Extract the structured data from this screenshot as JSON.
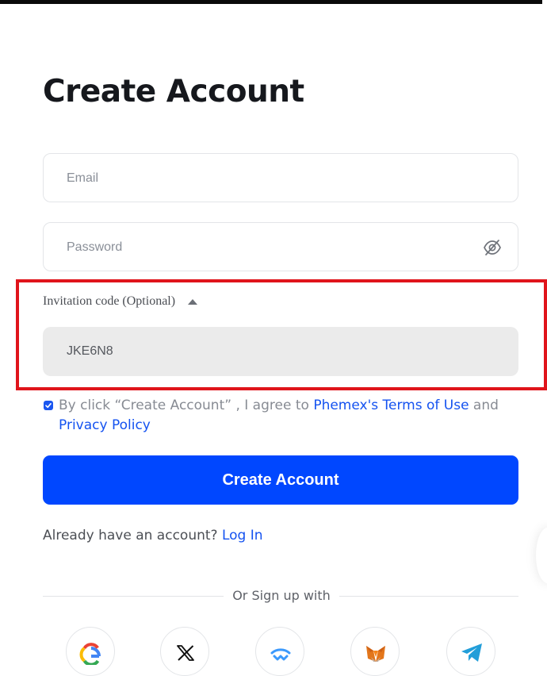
{
  "page": {
    "title": "Create Account"
  },
  "form": {
    "email_placeholder": "Email",
    "email_value": "",
    "password_placeholder": "Password",
    "password_value": "",
    "password_toggle_icon": "eye-slash-icon",
    "invitation_label": "Invitation code (Optional)",
    "invitation_toggle_icon": "caret-up-icon",
    "invitation_value": "JKE6N8"
  },
  "agreement": {
    "checked": true,
    "prefix": "By click “Create Account” , I agree to ",
    "terms_link": "Phemex's Terms of Use",
    "conjunction": " and ",
    "privacy_link": "Privacy Policy"
  },
  "submit": {
    "label": "Create Account"
  },
  "login": {
    "prompt": "Already have an account? ",
    "link": "Log In"
  },
  "social": {
    "divider_text": "Or Sign up with",
    "providers": [
      {
        "icon": "google-icon"
      },
      {
        "icon": "x-icon"
      },
      {
        "icon": "walletconnect-icon"
      },
      {
        "icon": "metamask-icon"
      },
      {
        "icon": "telegram-icon"
      }
    ]
  },
  "colors": {
    "primary": "#0047FF",
    "link": "#1452F0",
    "highlight_border": "#E0141B",
    "invite_field_bg": "#EBEBEB"
  }
}
